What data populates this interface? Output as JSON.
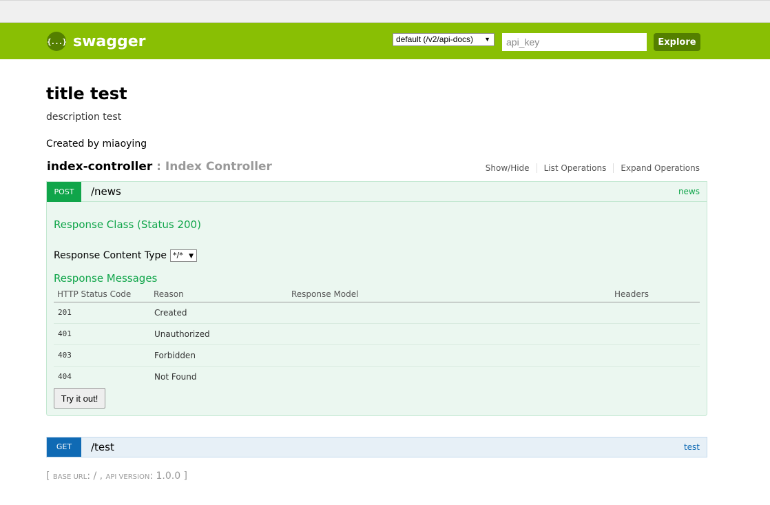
{
  "header": {
    "brand": "swagger",
    "logo_glyph": "{...}",
    "api_select": "default (/v2/api-docs)",
    "api_key_placeholder": "api_key",
    "explore_label": "Explore",
    "bg_color": "#89bf04"
  },
  "info": {
    "title": "title test",
    "description": "description test",
    "created_by": "Created by miaoying"
  },
  "resource": {
    "name": "index-controller",
    "separator": " : ",
    "description": "Index Controller",
    "options": [
      "Show/Hide",
      "List Operations",
      "Expand Operations"
    ]
  },
  "operations": [
    {
      "method": "POST",
      "path": "/news",
      "tag": "news",
      "response_class": "Response Class (Status 200)",
      "content_type_label": "Response Content Type",
      "content_type_value": "*/*",
      "messages_title": "Response Messages",
      "table_headers": [
        "HTTP Status Code",
        "Reason",
        "Response Model",
        "Headers"
      ],
      "rows": [
        {
          "code": "201",
          "reason": "Created"
        },
        {
          "code": "401",
          "reason": "Unauthorized"
        },
        {
          "code": "403",
          "reason": "Forbidden"
        },
        {
          "code": "404",
          "reason": "Not Found"
        }
      ],
      "try_label": "Try it out!",
      "color": "#10a54a"
    },
    {
      "method": "GET",
      "path": "/test",
      "tag": "test",
      "color": "#0f6ab4"
    }
  ],
  "footer": {
    "open": "[ ",
    "base_url_label": "base url",
    "base_url_value": ": / , ",
    "api_version_label": "api version",
    "api_version_value": ": 1.0.0 ]"
  }
}
